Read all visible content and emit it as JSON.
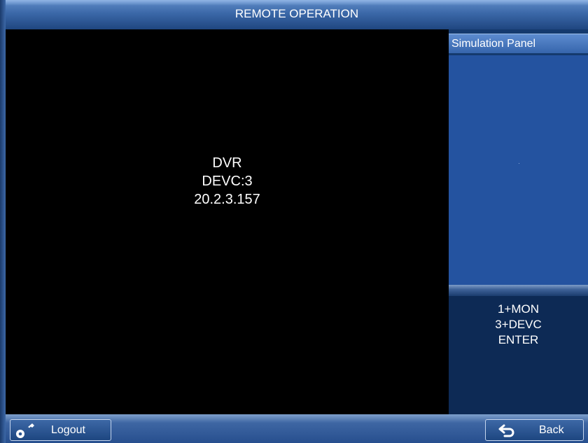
{
  "window": {
    "title": "REMOTE OPERATION"
  },
  "video": {
    "lines": [
      "DVR",
      "DEVC:3",
      "20.2.3.157"
    ]
  },
  "simulation_panel": {
    "title": "Simulation Panel",
    "commands": [
      "1+MON",
      "3+DEVC",
      "ENTER"
    ]
  },
  "footer": {
    "logout_label": "Logout",
    "logout_icon": "key-icon",
    "back_label": "Back",
    "back_icon": "return-arrow-icon"
  },
  "colors": {
    "title_bar": "#3b68a8",
    "video_background": "#000000",
    "sim_display": "#2453a0",
    "sim_commands_background": "#0d2a55"
  }
}
